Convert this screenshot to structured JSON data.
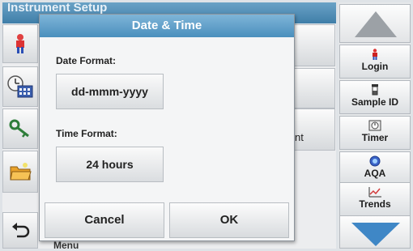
{
  "background": {
    "window_title": "Instrument Setup",
    "fragment_text": "nt",
    "bottom_text": "Menu"
  },
  "left_buttons": [
    {
      "icon": "operator-icon"
    },
    {
      "icon": "clock-calendar-icon"
    },
    {
      "icon": "key-icon"
    },
    {
      "icon": "folder-icon"
    },
    {
      "icon": "back-arrow-icon"
    }
  ],
  "sidebar": {
    "items": [
      {
        "label": "Login",
        "icon": "operator-icon"
      },
      {
        "label": "Sample ID",
        "icon": "sample-vial-icon"
      },
      {
        "label": "Timer",
        "icon": "timer-icon"
      },
      {
        "label": "AQA",
        "icon": "aqa-icon"
      },
      {
        "label": "Trends",
        "icon": "trends-chart-icon"
      }
    ],
    "scroll_up_icon": "arrow-up-icon",
    "scroll_down_icon": "arrow-down-icon"
  },
  "dialog": {
    "title": "Date & Time",
    "date_label": "Date Format:",
    "date_value": "dd-mmm-yyyy",
    "time_label": "Time Format:",
    "time_value": "24 hours",
    "cancel_label": "Cancel",
    "ok_label": "OK"
  },
  "colors": {
    "title_bar": "#4a8fbd",
    "scroll_arrow": "#3f87c6"
  }
}
